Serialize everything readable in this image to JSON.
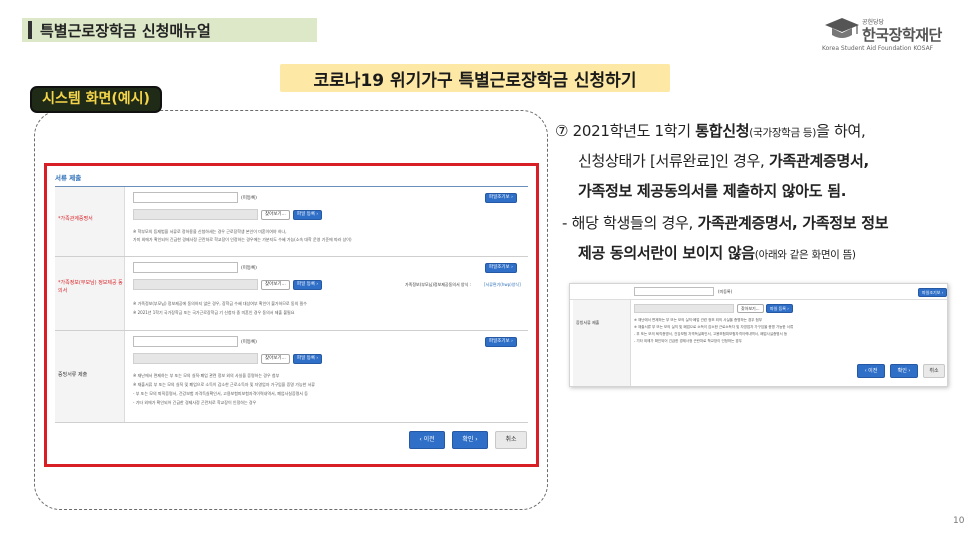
{
  "header": {
    "title": "특별근로장학금 신청매뉴얼",
    "logo_small": "공헌당당",
    "logo_main": "한국장학재단",
    "logo_eng": "Korea Student Aid Foundation KOSAF"
  },
  "main_title": "코로나19 위기가구 특별근로장학금 신청하기",
  "system_label": "시스템 화면(예시)",
  "form": {
    "section_title": "서류 제출",
    "view_button": "파일조기보 ›",
    "browse_button": "찾아보기...",
    "register_button": "파일 등록 ›",
    "unregistered": "(미등록)",
    "rows": [
      {
        "label": "*가족관계증명서",
        "notes": [
          "※ 학부모의 등재법을 서류로 정하용을 신청하세는 경우 근로장학생 본인이 미혼이여야 하나,",
          "  가미 외에가 확인되어 긴급한 경제사정 곤란처로 학교장이 인정하는 경우에는 가분지도 수혜 가능(소속 대학 운영 기준에 따라 상이)"
        ]
      },
      {
        "label": "*가족정보(부모님) 정보제공 동의서",
        "side_text": "가족정보(부모님)정보제공동의서 양식 :",
        "side_link": "[서류편기(hwp)양식]",
        "notes": [
          "※ 가족정보(부모님) 정보제공에 동의하지 않은 경우, 장학금 수혜 대상여부 확인이 불가하므로 동의 필수",
          "※ 2021년 1학기 국가장학금 또는 국가근로장학금 기 신청자 중 미혼인 경우 동의서 제출 불필요"
        ]
      },
      {
        "label": "증빙서류 제출",
        "notes": [
          "※ 재난에서 면제하는 부 또는 모의 실직·폐업 관련 정보 외의 사실을 증명하는 경우 첨부",
          "※ 재출서류 부 또는 모의 실직 및 폐업으로 소득이 감소한 근로소득자 및 자영업자 가구임을 증명 가능한 서류",
          "- 부 또는 모의 퇴직증명서, 건강보험 자격득실확인서, 고용보험피보험자격이력내역서, 폐업사실증명서 등",
          "- 기타 외에가 확인되어 긴급한 경제사정 곤란처로 학교장이 인정하는 경우"
        ]
      }
    ],
    "prev": "‹ 이전",
    "confirm": "확인 ›",
    "cancel": "취소"
  },
  "right": {
    "line1_a": "⑦ 2021학년도 1학기 ",
    "line1_b": "통합신청",
    "line1_c": "(국가장학금 등)",
    "line1_d": "을 하여,",
    "line2_a": "신청상태가 [서류완료]인 경우, ",
    "line2_b": "가족관계증명서,",
    "line3_b": "가족정보 제공동의서를 제출하지 않아도 됨.",
    "line4_a": "- 해당 학생들의 경우, ",
    "line4_b": "가족관계증명서, 가족정보 정보",
    "line5_b": "제공 동의서란이 보이지 않음",
    "line5_c": "(아래와 같은 화면이 뜸)"
  },
  "page_number": "10"
}
